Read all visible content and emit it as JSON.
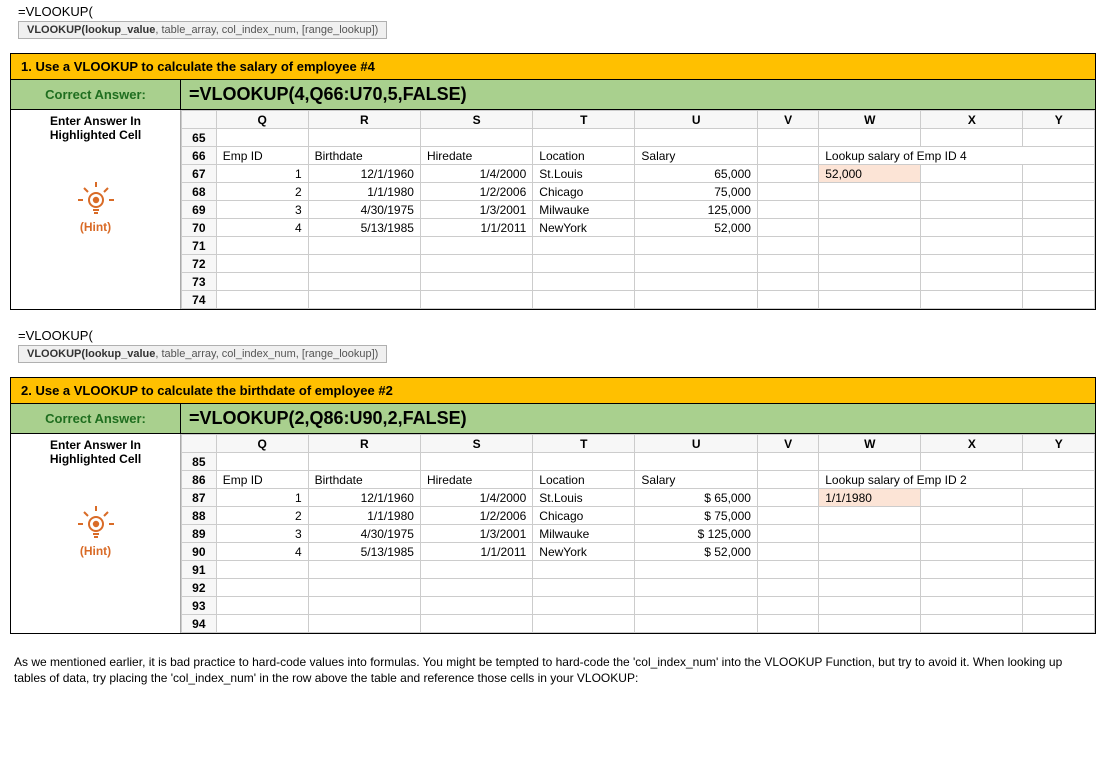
{
  "formulaBar": "=VLOOKUP(",
  "tooltip": {
    "fn": "VLOOKUP(",
    "arg1": "lookup_value",
    "rest": ", table_array, col_index_num, [range_lookup])"
  },
  "columns": [
    "Q",
    "R",
    "S",
    "T",
    "U",
    "V",
    "W",
    "X",
    "Y"
  ],
  "sidebar": {
    "line1": "Enter Answer In",
    "line2": "Highlighted Cell",
    "hint": "(Hint)"
  },
  "correctLabel": "Correct Answer:",
  "ex1": {
    "question": "1. Use a VLOOKUP to calculate the salary of employee #4",
    "formula": "=VLOOKUP(4,Q66:U70,5,FALSE)",
    "rowStart": 65,
    "rowEnd": 74,
    "headers": {
      "q": "Emp ID",
      "r": "Birthdate",
      "s": "Hiredate",
      "t": "Location",
      "u": "Salary",
      "w": "Lookup salary of Emp ID 4"
    },
    "rows": [
      {
        "q": "1",
        "r": "12/1/1960",
        "s": "1/4/2000",
        "t": "St.Louis",
        "u": "65,000"
      },
      {
        "q": "2",
        "r": "1/1/1980",
        "s": "1/2/2006",
        "t": "Chicago",
        "u": "75,000"
      },
      {
        "q": "3",
        "r": "4/30/1975",
        "s": "1/3/2001",
        "t": "Milwauke",
        "u": "125,000"
      },
      {
        "q": "4",
        "r": "5/13/1985",
        "s": "1/1/2011",
        "t": "NewYork",
        "u": "52,000"
      }
    ],
    "result": "52,000"
  },
  "ex2": {
    "question": "2. Use a VLOOKUP to calculate the birthdate of employee #2",
    "formula": "=VLOOKUP(2,Q86:U90,2,FALSE)",
    "rowStart": 85,
    "rowEnd": 94,
    "headers": {
      "q": "Emp ID",
      "r": "Birthdate",
      "s": "Hiredate",
      "t": "Location",
      "u": "Salary",
      "w": "Lookup salary of Emp ID 2"
    },
    "rows": [
      {
        "q": "1",
        "r": "12/1/1960",
        "s": "1/4/2000",
        "t": "St.Louis",
        "u": "$     65,000"
      },
      {
        "q": "2",
        "r": "1/1/1980",
        "s": "1/2/2006",
        "t": "Chicago",
        "u": "$     75,000"
      },
      {
        "q": "3",
        "r": "4/30/1975",
        "s": "1/3/2001",
        "t": "Milwauke",
        "u": "$   125,000"
      },
      {
        "q": "4",
        "r": "5/13/1985",
        "s": "1/1/2011",
        "t": "NewYork",
        "u": "$     52,000"
      }
    ],
    "result": "1/1/1980"
  },
  "footer": "As we mentioned earlier, it is bad practice to hard-code values into formulas. You might be tempted to hard-code the 'col_index_num' into the VLOOKUP Function, but try to avoid it. When looking up tables of data, try placing the 'col_index_num' in the row above the table and reference those cells in your VLOOKUP:"
}
